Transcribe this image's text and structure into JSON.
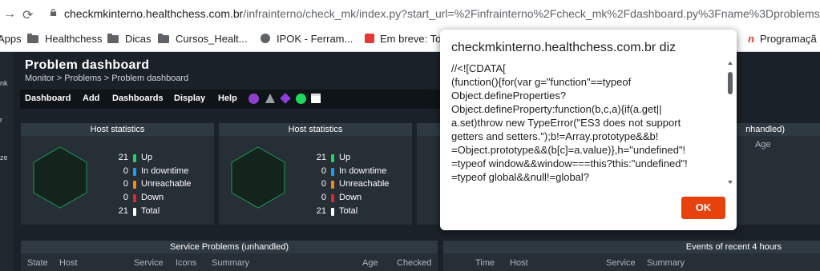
{
  "browser": {
    "url_domain": "checkmkinterno.healthchess.com.br",
    "url_path": "/infrainterno/check_mk/index.py?start_url=%2Finfrainterno%2Fcheck_mk%2Fdashboard.py%3Fname%3Dproblems"
  },
  "bookmarks": [
    {
      "label": "Apps",
      "icon": "grid-icon"
    },
    {
      "label": "Healthchess",
      "icon": "folder-icon"
    },
    {
      "label": "Dicas",
      "icon": "folder-icon"
    },
    {
      "label": "Cursos_Healt...",
      "icon": "folder-icon"
    },
    {
      "label": "IPOK - Ferram...",
      "icon": "globe-icon"
    },
    {
      "label": "Em breve: Tod",
      "icon": "app-icon"
    },
    {
      "label": "Programaçã",
      "icon": "app-icon"
    }
  ],
  "sidebar": {
    "snippets": [
      "nk",
      "r",
      "ze"
    ]
  },
  "dashboard": {
    "title": "Problem dashboard",
    "breadcrumb": "Monitor > Problems > Problem dashboard",
    "menu": [
      "Dashboard",
      "Add",
      "Dashboards",
      "Display",
      "Help"
    ],
    "host_stats": [
      {
        "title": "Host statistics",
        "rows": [
          {
            "count": "21",
            "label": "Up",
            "color": "#1ed760"
          },
          {
            "count": "0",
            "label": "In downtime",
            "color": "#1e9ee8"
          },
          {
            "count": "0",
            "label": "Unreachable",
            "color": "#f28c18"
          },
          {
            "count": "0",
            "label": "Down",
            "color": "#e02626"
          },
          {
            "count": "21",
            "label": "Total",
            "color": "#ffffff"
          }
        ]
      },
      {
        "title": "Host statistics",
        "rows": [
          {
            "count": "21",
            "label": "Up",
            "color": "#1ed760"
          },
          {
            "count": "0",
            "label": "In downtime",
            "color": "#1e9ee8"
          },
          {
            "count": "0",
            "label": "Unreachable",
            "color": "#f28c18"
          },
          {
            "count": "0",
            "label": "Down",
            "color": "#e02626"
          },
          {
            "count": "21",
            "label": "Total",
            "color": "#ffffff"
          }
        ]
      }
    ],
    "partial_dashlet": {
      "title_suffix": "nhandled)",
      "col": "Age"
    },
    "service_problems": {
      "title": "Service Problems (unhandled)",
      "columns": [
        "State",
        "Host",
        "Service",
        "Icons",
        "Summary",
        "Age",
        "Checked"
      ]
    },
    "events": {
      "title": "Events of recent 4 hours",
      "columns": [
        "Time",
        "Host",
        "Service",
        "Summary"
      ]
    }
  },
  "dialog": {
    "title": "checkmkinterno.healthchess.com.br diz",
    "lines": [
      "//<![CDATA[",
      "(function(){for(var g=\"function\"==typeof",
      "Object.defineProperties?",
      "Object.defineProperty:function(b,c,a){if(a.get||",
      "a.set)throw new TypeError(\"ES3 does not support",
      "getters and setters.\");b!=Array.prototype&&b!",
      "=Object.prototype&&(b[c]=a.value)},h=\"undefined\"!",
      "=typeof window&&window===this?this:\"undefined\"!",
      "=typeof global&&null!=global?"
    ],
    "ok_label": "OK"
  }
}
